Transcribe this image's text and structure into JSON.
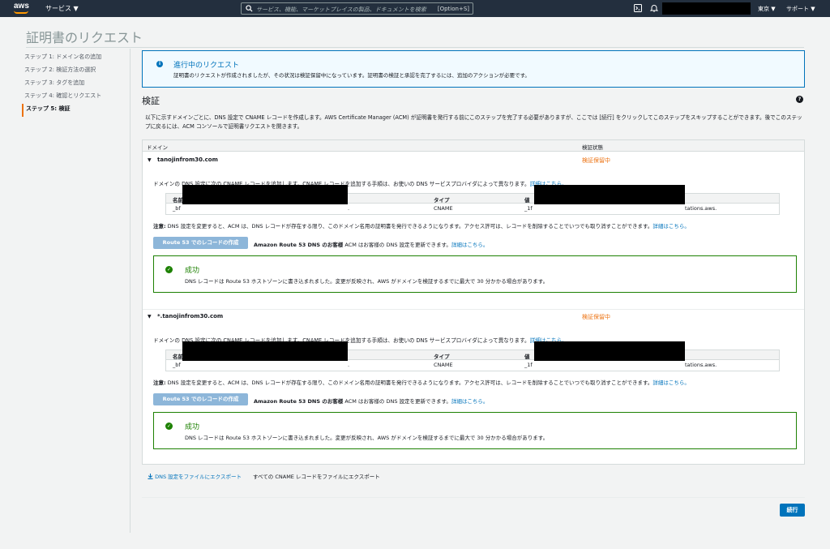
{
  "nav": {
    "logo": "aws",
    "services": "サービス ▼",
    "search_placeholder": "サービス、機能、マーケットプレイスの製品、ドキュメントを検索",
    "search_shortcut": "[Option+S]",
    "region": "東京 ▼",
    "support": "サポート ▼"
  },
  "page": {
    "title": "証明書のリクエスト"
  },
  "steps": [
    "ステップ 1: ドメイン名の追加",
    "ステップ 2: 検証方法の選択",
    "ステップ 3: タグを追加",
    "ステップ 4: 確認とリクエスト",
    "ステップ 5: 検証"
  ],
  "banner": {
    "title": "進行中のリクエスト",
    "text": "証明書のリクエストが作成されましたが、その状況は検証保留中になっています。証明書の検証と承認を完了するには、追加のアクションが必要です。"
  },
  "section": {
    "title": "検証",
    "intro": "以下に示すドメインごとに、DNS 設定で CNAME レコードを作成します。AWS Certificate Manager (ACM) が証明書を発行する前にこのステップを完了する必要がありますが、ここでは [続行] をクリックしてこのステップをスキップすることができます。後でこのステップに戻るには、ACM コンソールで証明書リクエストを開きます。"
  },
  "table": {
    "col_domain": "ドメイン",
    "col_status": "検証状態"
  },
  "domains": [
    {
      "name": "tanojinfrom30.com",
      "status": "検証保留中",
      "desc": "ドメインの DNS 設定に次の CNAME レコードを追加します。CNAME レコードを追加する手順は、お使いの DNS サービスプロバイダによって異なります。",
      "desc_link": "詳細はこちら。",
      "rec_h_name": "名前",
      "rec_h_type": "タイプ",
      "rec_h_value": "値",
      "rec_name": "_bf",
      "rec_name_tail": ".",
      "rec_type": "CNAME",
      "rec_value": "_1f",
      "rec_value_tail": "tations.aws.",
      "note_label": "注意:",
      "note": " DNS 設定を変更すると、ACM は、DNS レコードが存在する限り、このドメイン名用の証明書を発行できるようになります。アクセス許可は、レコードを削除することでいつでも取り消すことができます。",
      "note_link": "詳細はこちら。",
      "r53_button": "Route 53 でのレコードの作成",
      "r53_bold": "Amazon Route 53 DNS のお客様",
      "r53_text": " ACM はお客様の DNS 設定を更新できます。",
      "r53_link": "詳細はこちら。",
      "success_title": "成功",
      "success_text": "DNS レコードは Route 53 ホストゾーンに書き込まれました。変更が反映され、AWS がドメインを検証するまでに最大で 30 分かかる場合があります。"
    },
    {
      "name": "*.tanojinfrom30.com",
      "status": "検証保留中",
      "desc": "ドメインの DNS 設定に次の CNAME レコードを追加します。CNAME レコードを追加する手順は、お使いの DNS サービスプロバイダによって異なります。",
      "desc_link": "詳細はこちら。",
      "rec_h_name": "名前",
      "rec_h_type": "タイプ",
      "rec_h_value": "値",
      "rec_name": "_bf",
      "rec_name_tail": ".",
      "rec_type": "CNAME",
      "rec_value": "_1f",
      "rec_value_tail": "tations.aws.",
      "note_label": "注意:",
      "note": " DNS 設定を変更すると、ACM は、DNS レコードが存在する限り、このドメイン名用の証明書を発行できるようになります。アクセス許可は、レコードを削除することでいつでも取り消すことができます。",
      "note_link": "詳細はこちら。",
      "r53_button": "Route 53 でのレコードの作成",
      "r53_bold": "Amazon Route 53 DNS のお客様",
      "r53_text": " ACM はお客様の DNS 設定を更新できます。",
      "r53_link": "詳細はこちら。",
      "success_title": "成功",
      "success_text": "DNS レコードは Route 53 ホストゾーンに書き込まれました。変更が反映され、AWS がドメインを検証するまでに最大で 30 分かかる場合があります。"
    }
  ],
  "footer": {
    "export_link": "DNS 設定をファイルにエクスポート",
    "export_text": "すべての CNAME レコードをファイルにエクスポート",
    "continue": "続行"
  }
}
